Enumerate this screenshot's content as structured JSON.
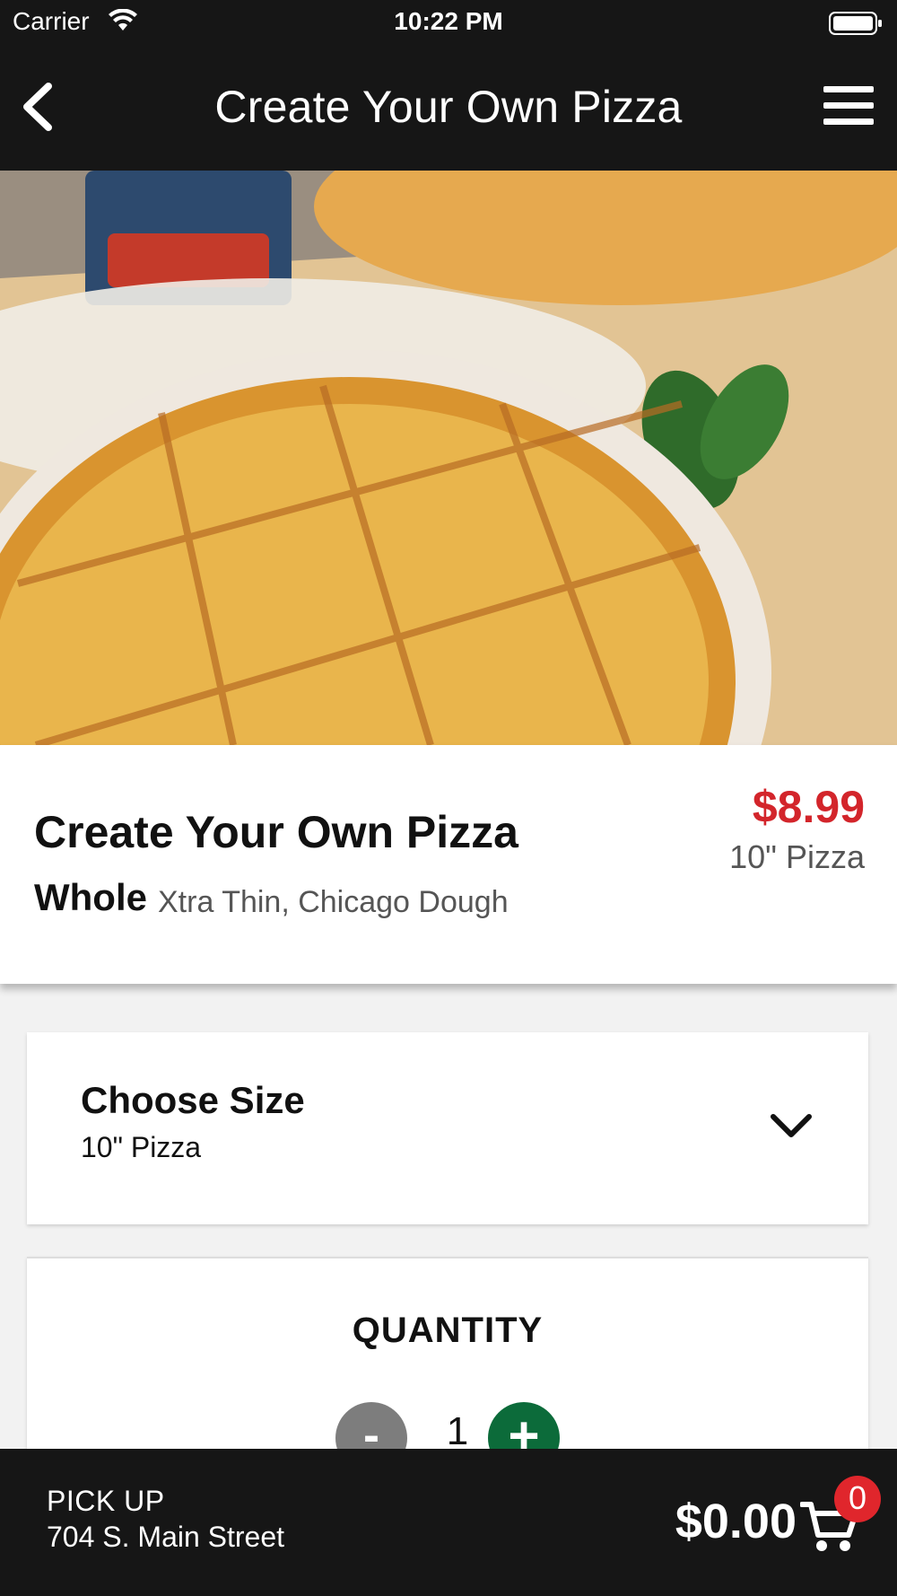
{
  "status_bar": {
    "carrier": "Carrier",
    "time": "10:22 PM",
    "icons": [
      "wifi-icon",
      "battery-icon"
    ]
  },
  "nav": {
    "title": "Create Your Own Pizza",
    "icons": [
      "back-chevron-icon",
      "hamburger-menu-icon"
    ]
  },
  "product": {
    "title": "Create Your Own Pizza",
    "variant": "Whole",
    "description": "Xtra Thin, Chicago Dough",
    "price": "$8.99",
    "price_size": "10\" Pizza",
    "price_color": "#d3252b"
  },
  "size_selector": {
    "title": "Choose Size",
    "selected": "10\" Pizza"
  },
  "quantity": {
    "title": "QUANTITY",
    "minus_label": "-",
    "value": "1",
    "plus_label": "+",
    "plus_color": "#0c6b3a",
    "minus_color": "#7d7d7d"
  },
  "bottom_bar": {
    "pickup_label": "PICK UP",
    "address": "704 S. Main Street",
    "total": "$0.00",
    "cart_count": "0",
    "badge_color": "#e0262c"
  },
  "hero": {
    "icon": "pizza-photo"
  }
}
